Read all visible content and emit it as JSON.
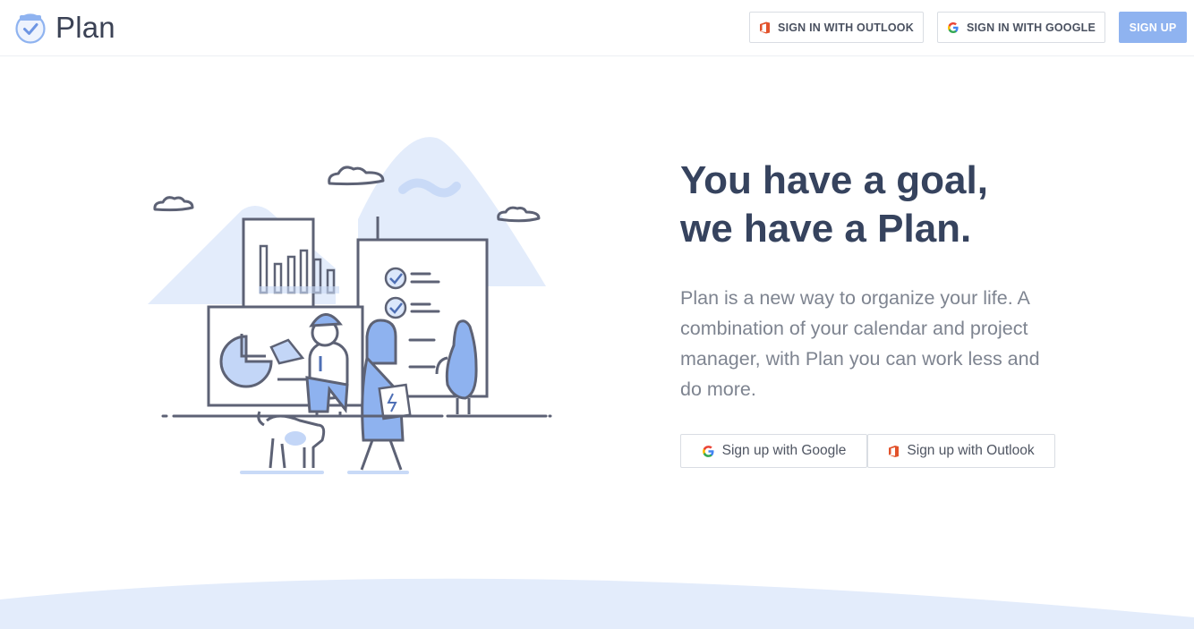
{
  "header": {
    "brand": "Plan",
    "outlook_label": "SIGN IN WITH OUTLOOK",
    "google_label": "SIGN IN WITH GOOGLE",
    "signup_label": "SIGN UP"
  },
  "hero": {
    "headline_line1": "You have a goal,",
    "headline_line2": "we have a Plan.",
    "description": "Plan is a new way to organize your life. A combination of your calendar and project manager, with Plan you can work less and do more.",
    "google_cta": "Sign up with Google",
    "outlook_cta": "Sign up with Outlook"
  },
  "icons": {
    "logo": "calendar-check-icon",
    "outlook": "office-icon",
    "google": "google-g-icon"
  },
  "colors": {
    "accent": "#8fb3f0",
    "illustration_light": "#e3ecfb",
    "illustration_mid": "#8eb2ef",
    "ink": "#5d6275",
    "headline": "#36435e",
    "body_text": "#7e8490",
    "office_red": "#e2522b"
  }
}
